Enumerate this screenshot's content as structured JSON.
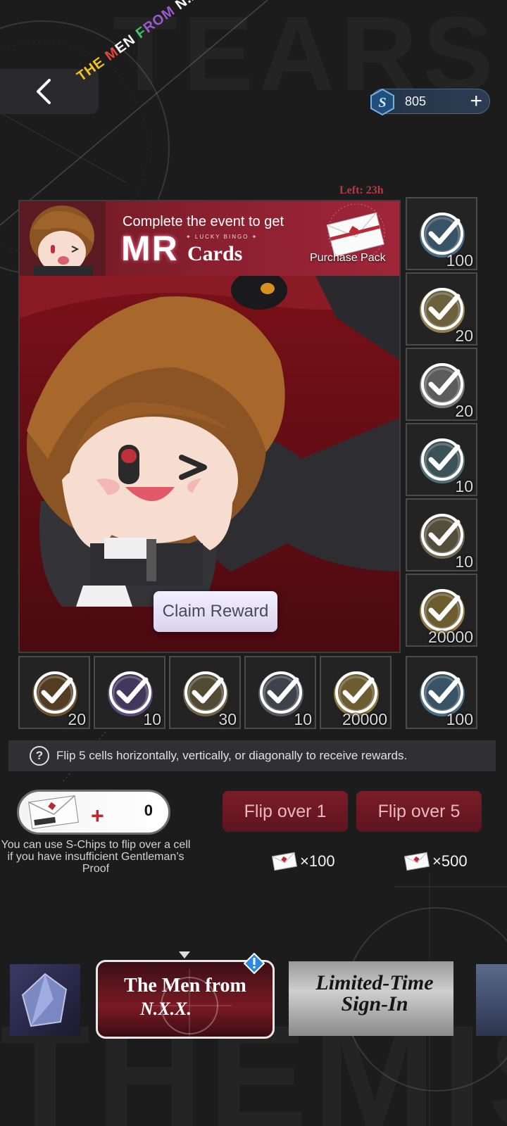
{
  "header": {
    "event_logo": [
      "THE",
      " M",
      "EN ",
      "F",
      "ROM",
      " N.X.X."
    ],
    "event_logo_colors": [
      "#f0c419",
      "#e8463c",
      "#ffffff",
      "#3ec26b",
      "#9b59d0",
      "#ffffff"
    ],
    "currency_amount": "805"
  },
  "bingo": {
    "time_left": "Left:  23h",
    "banner": {
      "line1": "Complete the event to get",
      "mr": "MR",
      "lucky": "✦ LUCKY  BINGO ✦",
      "cards": "Cards",
      "pack_label": "Purchase Pack"
    },
    "claim_label": "Claim Reward",
    "right_column": [
      {
        "item": "s-chip-icon",
        "qty": "100",
        "color": "#5a8aa8"
      },
      {
        "item": "gold-record-icon",
        "qty": "20",
        "color": "#b8a060"
      },
      {
        "item": "scissors-icon",
        "qty": "20",
        "color": "#9a9a9a"
      },
      {
        "item": "chip-badge-icon",
        "qty": "10",
        "color": "#5f8a90"
      },
      {
        "item": "book-icon",
        "qty": "10",
        "color": "#8a8260"
      },
      {
        "item": "gold-coin-icon",
        "qty": "20000",
        "color": "#b89a4a"
      }
    ],
    "bottom_row": [
      {
        "item": "bronze-medal-icon",
        "qty": "20",
        "color": "#8a6030"
      },
      {
        "item": "purple-medal-icon",
        "qty": "10",
        "color": "#6a5a9a"
      },
      {
        "item": "gold-card-icon",
        "qty": "30",
        "color": "#8a7a50"
      },
      {
        "item": "purple-card-icon",
        "qty": "10",
        "color": "#6a6a7a"
      },
      {
        "item": "gold-coin-icon",
        "qty": "20000",
        "color": "#b89a4a"
      },
      {
        "item": "s-chip-icon",
        "qty": "100",
        "color": "#5a8aa8"
      }
    ],
    "hint": "Flip 5 cells horizontally, vertically, or diagonally to receive rewards."
  },
  "controls": {
    "proof_count": "0",
    "proof_hint": "You can use S-Chips to flip over a cell if you have insufficient Gentleman’s Proof",
    "flip1_label": "Flip over 1",
    "flip5_label": "Flip over 5",
    "flip1_cost": "×100",
    "flip5_cost": "×500"
  },
  "tabs": {
    "active_title": "The Men from",
    "active_sub": "N.X.X.",
    "signin_title": "Limited-Time Sign-In"
  },
  "colors": {
    "accent_red": "#7a1d28",
    "chip_blue": "#2d5f8a"
  }
}
